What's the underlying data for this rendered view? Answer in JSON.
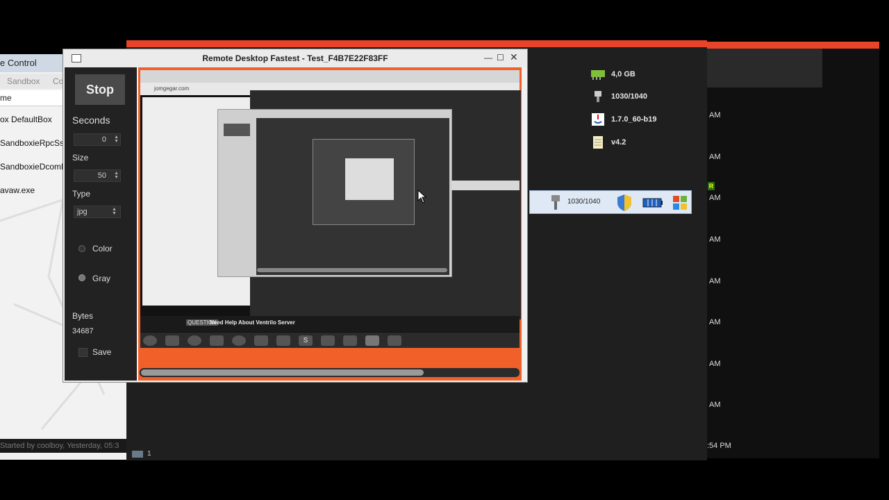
{
  "remote_window": {
    "title": "Remote Desktop Fastest - Test_F4B7E22F83FF",
    "stop_label": "Stop",
    "seconds_label": "Seconds",
    "seconds_value": "0",
    "size_label": "Size",
    "size_value": "50",
    "type_label": "Type",
    "type_value": "jpg",
    "color_label": "Color",
    "gray_label": "Gray",
    "bytes_label": "Bytes",
    "bytes_value": "34687",
    "save_label": "Save",
    "progress": 0.75
  },
  "sandboxie": {
    "title": "e Control",
    "menu": [
      "Sandbox",
      "Co"
    ],
    "column": "me",
    "items": [
      "ox DefaultBox",
      "SandboxieRpcSs.",
      "SandboxieDcomL",
      "avaw.exe"
    ],
    "footer": "Started by coolboy, Yesterday, 05:3"
  },
  "info_panel": {
    "memory": "4,0 GB",
    "display": "1030/1040",
    "java": "1.7.0_60-b19",
    "version": "v4.2"
  },
  "statusbar": {
    "value": "1030/1040"
  },
  "right_window": {
    "times": [
      "AM",
      "AM",
      "AM",
      "AM",
      "AM",
      "AM",
      "AM",
      "AM"
    ],
    "last_time": ":54 PM",
    "badge": "R"
  },
  "inner_screen": {
    "url": "jomgegar.com",
    "forum_tag": "QUESTION",
    "forum_title": "Need Help About Ventrilo Server",
    "taskbar_s": "S"
  },
  "bottom_counter": "1"
}
